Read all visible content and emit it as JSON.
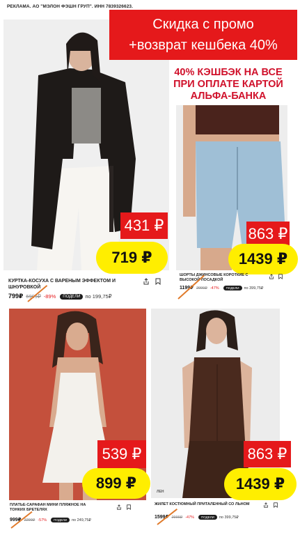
{
  "ad_note": "РЕКЛАМА. АО \"МЭЛОН ФЭШН ГРУП\". ИНН 7839326623.",
  "promo": {
    "line1": "Скидка с промо",
    "line2": "+возврат кешбека 40%",
    "cashback_lines": [
      "40% КЭШБЭК НА ВСЕ",
      "ПРИ ОПЛАТЕ КАРТОЙ",
      "АЛЬФА-БАНКА"
    ]
  },
  "podeli_label": "ПОДЕЛИ",
  "products": [
    {
      "title": "КУРТКА-КОСУХА С ВАРЕНЫМ ЭФФЕКТОМ И ШНУРОВКОЙ",
      "price": "799₽",
      "old_price": "6999₽",
      "discount": "-89%",
      "installment": "по 199,75₽",
      "promo_price": "431 ₽",
      "final_price": "719 ₽"
    },
    {
      "title": "ШОРТЫ ДЖИНСОВЫЕ КОРОТКИЕ С ВЫСОКОЙ ПОСАДКОЙ",
      "price": "1199₽",
      "old_price": "2999₽",
      "discount": "-47%",
      "installment": "по 399,75₽",
      "promo_price": "863 ₽",
      "final_price": "1439 ₽"
    },
    {
      "title": "ПЛАТЬЕ-САРАФАН МИНИ ПЛЯЖНОЕ НА ТОНКИХ БРЕТЕЛЯХ",
      "price": "999₽",
      "old_price": "2299₽",
      "discount": "-57%",
      "installment": "по 249,75₽",
      "promo_price": "539 ₽",
      "final_price": "899 ₽"
    },
    {
      "title": "ЖИЛЕТ КОСТЮМНЫЙ ПРИТАЛЕННЫЙ СО ЛЬНОМ",
      "price": "1599₽",
      "old_price": "2999₽",
      "discount": "-47%",
      "installment": "по 399,75₽",
      "promo_price": "863 ₽",
      "final_price": "1439 ₽",
      "material_tag": "ЛЕН"
    }
  ]
}
